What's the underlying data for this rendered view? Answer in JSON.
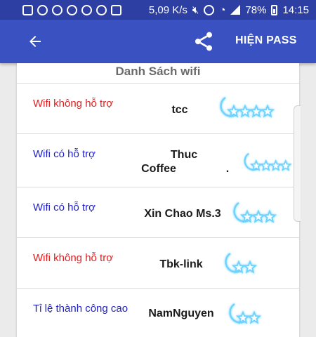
{
  "status_bar": {
    "speed": "5,09 K/s",
    "battery": "78%",
    "time": "14:15"
  },
  "app_bar": {
    "hien_pass_label": "HIỆN PASS"
  },
  "list": {
    "title": "Danh Sách wifi",
    "items": [
      {
        "status": "Wifi không hỗ trợ",
        "status_color": "red",
        "name_line1": "tcc",
        "name_line2": "",
        "stars": 4
      },
      {
        "status": "Wifi có hỗ trợ",
        "status_color": "blue",
        "name_line1": "Thuc",
        "name_line2": "Coffee",
        "extra": ".",
        "stars": 4
      },
      {
        "status": "Wifi có hỗ trợ",
        "status_color": "blue",
        "name_line1": "Xin Chao Ms.3",
        "name_line2": "",
        "stars": 3
      },
      {
        "status": "Wifi không hỗ trợ",
        "status_color": "red",
        "name_line1": "Tbk-link",
        "name_line2": "",
        "stars": 2
      },
      {
        "status": "Tỉ lệ thành công cao",
        "status_color": "blue",
        "name_line1": "NamNguyen",
        "name_line2": "",
        "stars": 2
      }
    ]
  },
  "colors": {
    "status_bar": "#2e3fa3",
    "app_bar": "#3a51c2",
    "red_text": "#e01f1f",
    "blue_text": "#1f1fc4",
    "star_glow": "#6fd3ff"
  }
}
